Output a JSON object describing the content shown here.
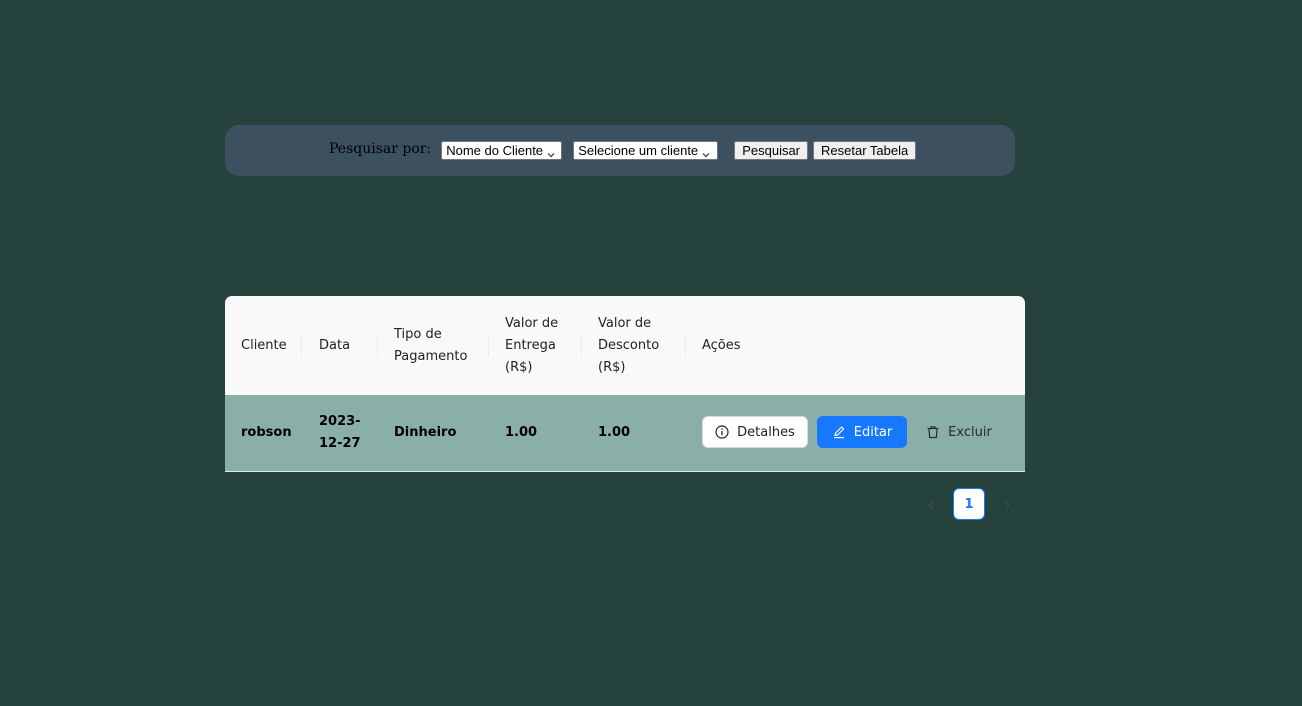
{
  "search": {
    "label": "Pesquisar por:",
    "filter_select_value": "Nome do Cliente",
    "client_select_value": "Selecione um cliente",
    "search_button": "Pesquisar",
    "reset_button": "Resetar Tabela"
  },
  "table": {
    "headers": {
      "cliente": "Cliente",
      "data": "Data",
      "tipo_pagamento": [
        "Tipo de",
        "Pagamento"
      ],
      "valor_entrega": [
        "Valor de",
        "Entrega",
        "(R$)"
      ],
      "valor_desconto": [
        "Valor de",
        "Desconto",
        "(R$)"
      ],
      "acoes": "Ações"
    },
    "rows": [
      {
        "cliente": "robson",
        "data": [
          "2023-",
          "12-27"
        ],
        "tipo_pagamento": "Dinheiro",
        "valor_entrega": "1.00",
        "valor_desconto": "1.00"
      }
    ],
    "actions": {
      "details": "Detalhes",
      "edit": "Editar",
      "delete": "Excluir"
    }
  },
  "pagination": {
    "current_page": "1"
  },
  "colors": {
    "background": "#26423d",
    "search_bar": "#3c5060",
    "row_background": "#8aafa9",
    "primary": "#1677ff"
  },
  "icons": {
    "details": "info-circle-icon",
    "edit": "edit-pencil-icon",
    "delete": "trash-icon",
    "prev": "chevron-left-icon",
    "next": "chevron-right-icon",
    "select_arrow": "chevron-down-icon"
  }
}
